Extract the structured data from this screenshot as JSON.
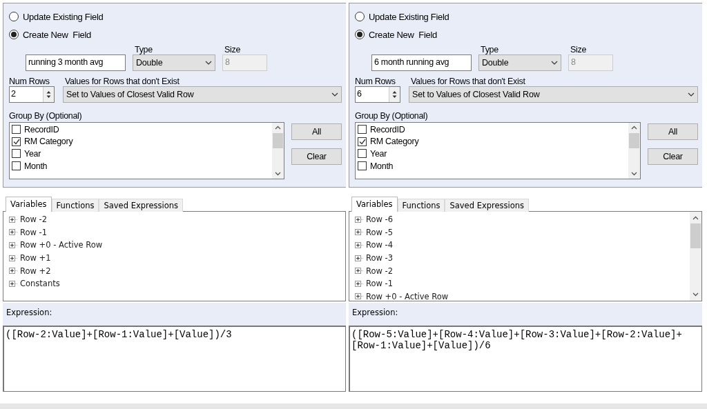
{
  "panels": [
    {
      "field_mode": [
        {
          "label": "Update Existing Field",
          "selected": false
        },
        {
          "label": "Create New  Field",
          "selected": true
        }
      ],
      "new_field": {
        "value": "running 3 month avg",
        "type_label": "Type",
        "type_value": "Double",
        "size_label": "Size",
        "size_value": "8",
        "size_disabled": true
      },
      "num_rows": {
        "label": "Num Rows",
        "value": "2"
      },
      "missing_rows": {
        "label": "Values for Rows that don't Exist",
        "value": "Set to Values of Closest Valid Row"
      },
      "group_by": {
        "label": "Group By (Optional)",
        "items": [
          {
            "label": "RecordID",
            "checked": false
          },
          {
            "label": "RM Category",
            "checked": true
          },
          {
            "label": "Year",
            "checked": false
          },
          {
            "label": "Month",
            "checked": false
          }
        ]
      },
      "buttons": [
        "All",
        "Clear"
      ],
      "tabs": [
        {
          "label": "Variables",
          "selected": true
        },
        {
          "label": "Functions",
          "selected": false
        },
        {
          "label": "Saved Expressions",
          "selected": false
        }
      ],
      "variables": [
        {
          "label": "Row -2",
          "expanded": false
        },
        {
          "label": "Row -1",
          "expanded": false
        },
        {
          "label": "Row +0 - Active Row",
          "expanded": false
        },
        {
          "label": "Row +1",
          "expanded": false
        },
        {
          "label": "Row +2",
          "expanded": false
        },
        {
          "label": "Constants",
          "expanded": false
        }
      ],
      "expression": {
        "label": "Expression:",
        "value": "([Row-2:Value]+[Row-1:Value]+[Value])/3"
      }
    },
    {
      "field_mode": [
        {
          "label": "Update Existing Field",
          "selected": false
        },
        {
          "label": "Create New  Field",
          "selected": true
        }
      ],
      "new_field": {
        "value": "6 month running avg",
        "type_label": "Type",
        "type_value": "Double",
        "size_label": "Size",
        "size_value": "8",
        "size_disabled": true
      },
      "num_rows": {
        "label": "Num Rows",
        "value": "6"
      },
      "missing_rows": {
        "label": "Values for Rows that don't Exist",
        "value": "Set to Values of Closest Valid Row"
      },
      "group_by": {
        "label": "Group By (Optional)",
        "items": [
          {
            "label": "RecordID",
            "checked": false
          },
          {
            "label": "RM Category",
            "checked": true
          },
          {
            "label": "Year",
            "checked": false
          },
          {
            "label": "Month",
            "checked": false
          }
        ]
      },
      "buttons": [
        "All",
        "Clear"
      ],
      "tabs": [
        {
          "label": "Variables",
          "selected": true
        },
        {
          "label": "Functions",
          "selected": false
        },
        {
          "label": "Saved Expressions",
          "selected": false
        }
      ],
      "variables": [
        {
          "label": "Row -6",
          "expanded": false
        },
        {
          "label": "Row -5",
          "expanded": false
        },
        {
          "label": "Row -4",
          "expanded": false
        },
        {
          "label": "Row -3",
          "expanded": false
        },
        {
          "label": "Row -2",
          "expanded": false
        },
        {
          "label": "Row -1",
          "expanded": false
        },
        {
          "label": "Row +0 - Active Row",
          "expanded": false
        }
      ],
      "expression": {
        "label": "Expression:",
        "value": "([Row-5:Value]+[Row-4:Value]+[Row-3:Value]+[Row-2:Value]+[Row-1:Value]+[Value])/6"
      }
    }
  ]
}
